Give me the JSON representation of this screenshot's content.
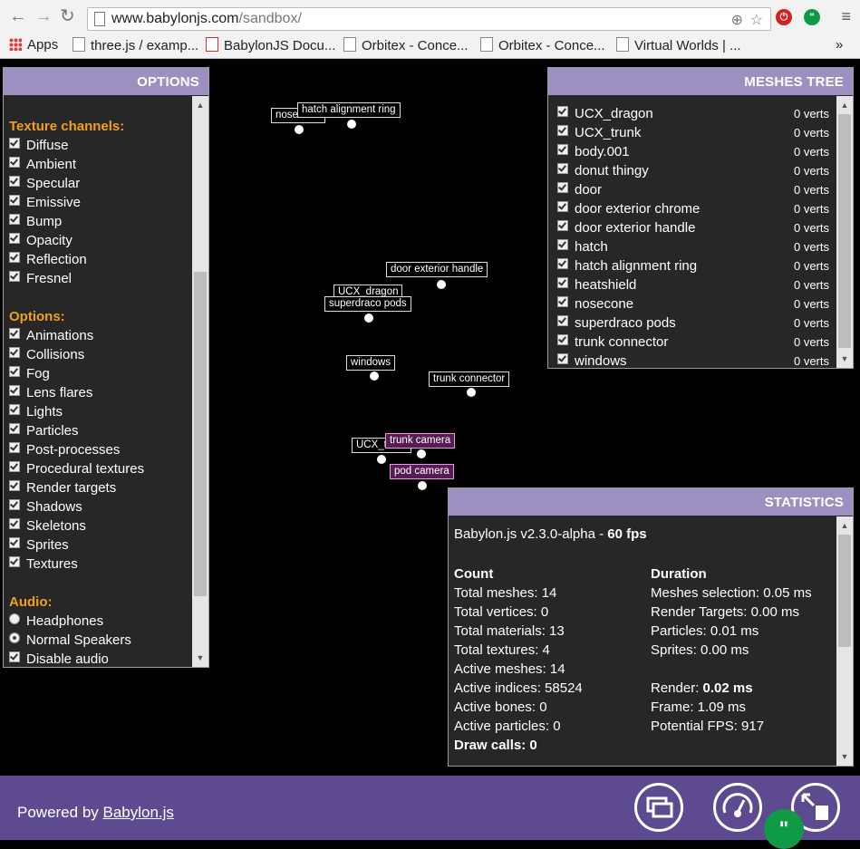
{
  "browser": {
    "url_domain": "www.babylonjs.com",
    "url_path": "/sandbox/",
    "bookmarks": [
      "Apps",
      "three.js / examp...",
      "BabylonJS Docu...",
      "Orbitex - Conce...",
      "Orbitex - Conce...",
      "Virtual Worlds | ..."
    ],
    "more_bookmarks": "»"
  },
  "options": {
    "title": "OPTIONS",
    "texture_channels_title": "Texture channels:",
    "texture_channels": [
      "Diffuse",
      "Ambient",
      "Specular",
      "Emissive",
      "Bump",
      "Opacity",
      "Reflection",
      "Fresnel"
    ],
    "options_title": "Options:",
    "options": [
      "Animations",
      "Collisions",
      "Fog",
      "Lens flares",
      "Lights",
      "Particles",
      "Post-processes",
      "Procedural textures",
      "Render targets",
      "Shadows",
      "Skeletons",
      "Sprites",
      "Textures"
    ],
    "audio_title": "Audio:",
    "audio_radios": [
      "Headphones",
      "Normal Speakers"
    ],
    "audio_selected": "Normal Speakers",
    "disable_audio": "Disable audio"
  },
  "meshes_tree": {
    "title": "MESHES TREE",
    "items": [
      {
        "name": "UCX_dragon",
        "verts": "0 verts"
      },
      {
        "name": "UCX_trunk",
        "verts": "0 verts"
      },
      {
        "name": "body.001",
        "verts": "0 verts"
      },
      {
        "name": "donut thingy",
        "verts": "0 verts"
      },
      {
        "name": "door",
        "verts": "0 verts"
      },
      {
        "name": "door exterior chrome",
        "verts": "0 verts"
      },
      {
        "name": "door exterior handle",
        "verts": "0 verts"
      },
      {
        "name": "hatch",
        "verts": "0 verts"
      },
      {
        "name": "hatch alignment ring",
        "verts": "0 verts"
      },
      {
        "name": "heatshield",
        "verts": "0 verts"
      },
      {
        "name": "nosecone",
        "verts": "0 verts"
      },
      {
        "name": "superdraco pods",
        "verts": "0 verts"
      },
      {
        "name": "trunk connector",
        "verts": "0 verts"
      },
      {
        "name": "windows",
        "verts": "0 verts"
      }
    ]
  },
  "statistics": {
    "title": "STATISTICS",
    "version_prefix": "Babylon.js v2.3.0-alpha - ",
    "fps": "60 fps",
    "count_title": "Count",
    "count_rows": [
      "Total meshes: 14",
      "Total vertices: 0",
      "Total materials: 13",
      "Total textures: 4",
      "Active meshes: 14",
      "Active indices: 58524",
      "Active bones: 0",
      "Active particles: 0"
    ],
    "draw_calls": "Draw calls: 0",
    "duration_title": "Duration",
    "duration_rows": [
      "Meshes selection: 0.05 ms",
      "Render Targets: 0.00 ms",
      "Particles: 0.01 ms",
      "Sprites: 0.00 ms"
    ],
    "render_prefix": "Render: ",
    "render_value": "0.02 ms",
    "frame": "Frame: 1.09 ms",
    "potential_fps": "Potential FPS: 917"
  },
  "scene_labels": {
    "nosecone": "nosecone",
    "hatch_alignment_ring": "hatch alignment ring",
    "door_exterior_handle": "door exterior handle",
    "ucx_dragon": "UCX_dragon",
    "superdraco_pods": "superdraco pods",
    "windows": "windows",
    "trunk_connector": "trunk connector",
    "ucx_trunk": "UCX_trunk",
    "trunk_camera": "trunk camera",
    "pod_camera": "pod camera"
  },
  "footer": {
    "powered_prefix": "Powered by ",
    "powered_link": "Babylon.js"
  },
  "colors": {
    "panel_header": "#9d8fbf",
    "section_title": "#f0a020",
    "footer_bg": "#5d4a91"
  }
}
